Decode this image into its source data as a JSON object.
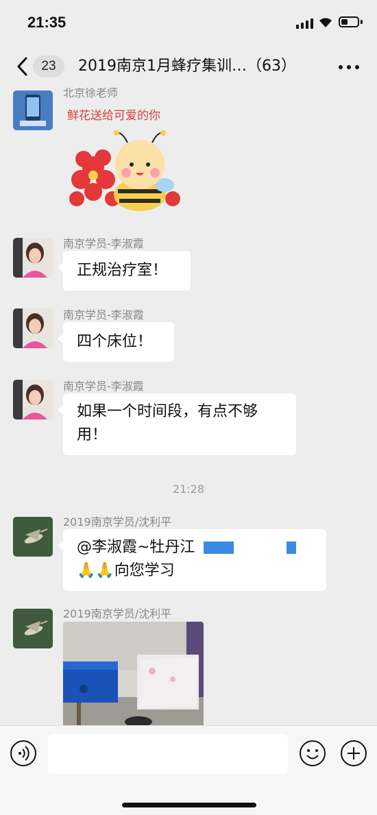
{
  "status_bar": {
    "time": "21:35"
  },
  "nav": {
    "back_count": "23",
    "title": "2019南京1月蜂疗集训…（63）"
  },
  "messages": [
    {
      "sender": "北京徐老师",
      "type": "sticker",
      "sticker_text": "鲜花送给可爱的你"
    },
    {
      "sender": "南京学员-李淑霞",
      "text": "正规治疗室！"
    },
    {
      "sender": "南京学员-李淑霞",
      "text": "四个床位！"
    },
    {
      "sender": "南京学员-李淑霞",
      "text_line1": "如果一个时间段，有点不够",
      "text_line2": "用！"
    },
    {
      "sender": "2019南京学员/沈利平",
      "text_line1": "@李淑霞~牡丹江",
      "text_line2": "🙏🙏向您学习"
    },
    {
      "sender": "2019南京学员/沈利平",
      "type": "image"
    }
  ],
  "time_divider": "21:28",
  "colors": {
    "background": "#ededed",
    "bubble": "#ffffff",
    "redaction": "#3a8ae6"
  },
  "icons": [
    "back-icon",
    "more-icon",
    "voice-icon",
    "emoji-icon",
    "plus-icon"
  ]
}
